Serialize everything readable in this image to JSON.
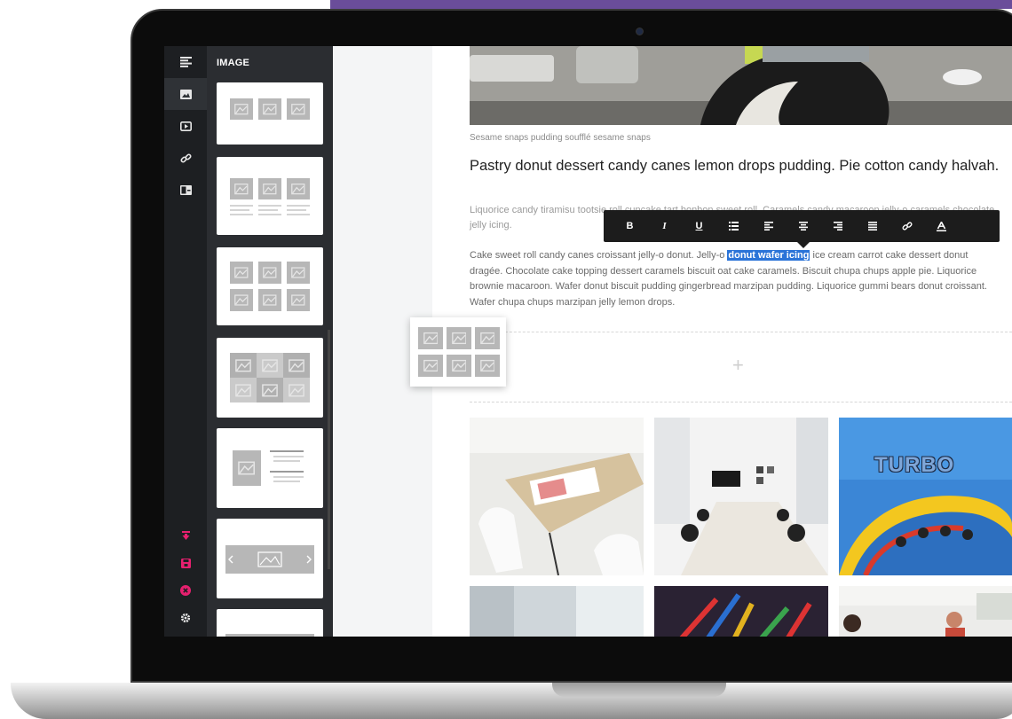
{
  "colors": {
    "accent_purple": "#6a4d9a",
    "rail_bg": "#1d1f22",
    "panel_bg": "#2b2d31",
    "pink_action": "#e6206f",
    "highlight": "#2b74d8"
  },
  "panel": {
    "title": "IMAGE"
  },
  "rail": {
    "top_icons": [
      "paragraph-icon",
      "image-icon",
      "video-icon",
      "link-icon",
      "card-icon"
    ],
    "bottom_icons": [
      "download-icon",
      "save-icon",
      "close-circle-icon",
      "gear-icon"
    ]
  },
  "content": {
    "caption": "Sesame snaps pudding soufflé sesame snaps",
    "headline": "Pastry donut dessert candy canes lemon drops pudding. Pie cotton candy halvah.",
    "para1": "Liquorice candy tiramisu tootsie roll cupcake tart bonbon sweet roll. Caramels candy macaroon jelly-o caramels chocolate jelly icing.",
    "para2_before": "Cake sweet roll candy canes croissant jelly-o donut. Jelly-o ",
    "para2_highlight": "donut wafer icing",
    "para2_after": " ice cream carrot cake dessert donut dragée. Chocolate cake topping dessert caramels biscuit oat cake caramels. Biscuit chupa chups apple pie. Liquorice brownie macaroon. Wafer donut biscuit pudding gingerbread marzipan pudding. Liquorice gummi bears donut croissant. Wafer chupa chups marzipan jelly lemon drops.",
    "dropzone_symbol": "+",
    "sign_text": "TURBO"
  },
  "toolbar": {
    "bold": "B",
    "italic": "I",
    "underline": "U",
    "buttons": [
      "bold",
      "italic",
      "underline",
      "list-icon",
      "align-left-icon",
      "align-center-icon",
      "align-right-icon",
      "align-justify-icon",
      "link-icon",
      "text-color-icon"
    ]
  }
}
